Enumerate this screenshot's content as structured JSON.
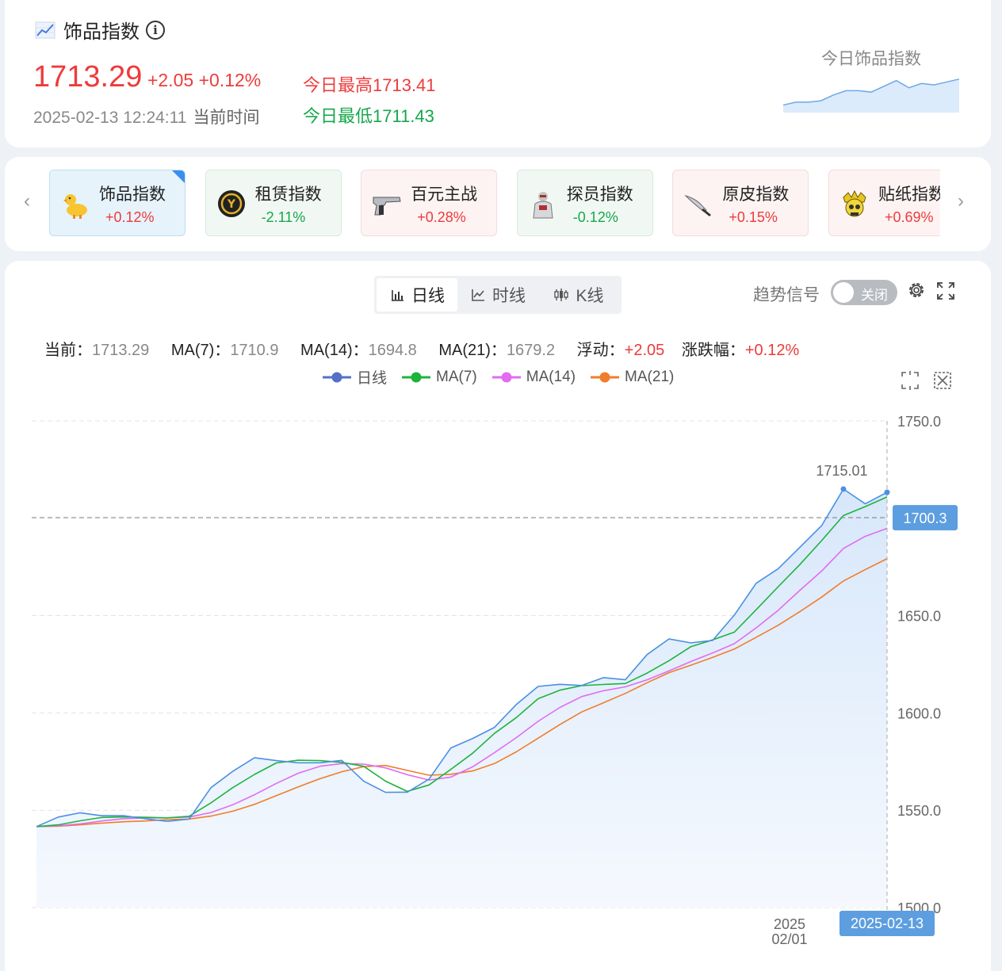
{
  "header": {
    "title": "饰品指数",
    "price": "1713.29",
    "change": "+2.05 +0.12%",
    "datetime": "2025-02-13 12:24:11",
    "datetime_suffix": "当前时间",
    "high_label": "今日最高1713.41",
    "low_label": "今日最低1711.43",
    "spark_label": "今日饰品指数",
    "spark_values": [
      1711.6,
      1711.8,
      1711.8,
      1711.9,
      1712.3,
      1712.6,
      1712.6,
      1712.5,
      1712.9,
      1713.3,
      1712.8,
      1713.1,
      1713.0,
      1713.2,
      1713.4
    ]
  },
  "tabs": [
    {
      "name": "饰品指数",
      "pct": "+0.12%",
      "state": "active",
      "icon": "duck-icon"
    },
    {
      "name": "租赁指数",
      "pct": "-2.11%",
      "state": "down",
      "icon": "coin-icon"
    },
    {
      "name": "百元主战",
      "pct": "+0.28%",
      "state": "up",
      "icon": "pistol-icon"
    },
    {
      "name": "探员指数",
      "pct": "-0.12%",
      "state": "down",
      "icon": "agent-icon"
    },
    {
      "name": "原皮指数",
      "pct": "+0.15%",
      "state": "up",
      "icon": "knife-icon"
    },
    {
      "name": "贴纸指数",
      "pct": "+0.69%",
      "state": "up",
      "icon": "skull-icon"
    }
  ],
  "toolbar": {
    "segments": [
      "日线",
      "时线",
      "K线"
    ],
    "active_segment": "日线",
    "trend_label": "趋势信号",
    "toggle_label": "关闭",
    "toggle_on": false
  },
  "stats": {
    "current_label": "当前：",
    "current_value": "1713.29",
    "ma7_label": "MA(7)：",
    "ma7_value": "1710.9",
    "ma14_label": "MA(14)：",
    "ma14_value": "1694.8",
    "ma21_label": "MA(21)：",
    "ma21_value": "1679.2",
    "float_label": "浮动：",
    "float_value": "+2.05",
    "pct_label": "涨跌幅：",
    "pct_value": "+0.12%"
  },
  "chart_data": {
    "type": "line",
    "ylim": [
      1500,
      1750
    ],
    "y_ticks": [
      "1750.0",
      "1650.0",
      "1600.0",
      "1550.0",
      "1500.0"
    ],
    "x_tick_label_line1": "2025",
    "x_tick_label_line2": "02/01",
    "x_axis_pointer_label": "2025-02-13",
    "y_axis_pointer_label": "1700.3",
    "max_label": "1715.01",
    "series": [
      {
        "name": "日线",
        "color": "#4a90e2",
        "values": [
          1541.6,
          1546.5,
          1548.7,
          1547.2,
          1547.2,
          1545.6,
          1544.3,
          1545.5,
          1561.6,
          1570.0,
          1577.0,
          1575.5,
          1574.4,
          1574.4,
          1575.6,
          1565.0,
          1559.2,
          1559.3,
          1566.0,
          1582.0,
          1586.9,
          1592.6,
          1604.3,
          1613.6,
          1614.7,
          1614.1,
          1618.1,
          1617.0,
          1630.0,
          1638.0,
          1636.0,
          1637.2,
          1650.3,
          1666.6,
          1674.0,
          1685.0,
          1696.2,
          1715.0,
          1707.4,
          1713.3
        ]
      },
      {
        "name": "MA(7)",
        "color": "#1db43c",
        "values": [
          1541.6,
          1542.5,
          1544.6,
          1546.3,
          1546.6,
          1546.4,
          1546.1,
          1546.9,
          1553.8,
          1561.6,
          1568.4,
          1574.3,
          1575.7,
          1575.5,
          1574.6,
          1572.6,
          1565.0,
          1559.7,
          1563.0,
          1571.0,
          1579.3,
          1589.5,
          1597.6,
          1607.3,
          1611.7,
          1614.0,
          1614.6,
          1615.1,
          1620.5,
          1626.8,
          1634.0,
          1637.5,
          1641.5,
          1653.0,
          1664.7,
          1676.2,
          1688.5,
          1701.4,
          1706.0,
          1710.9
        ]
      },
      {
        "name": "MA(14)",
        "color": "#e06cf0",
        "values": [
          1541.6,
          1542.0,
          1543.0,
          1544.5,
          1545.7,
          1546.0,
          1546.1,
          1546.5,
          1548.8,
          1552.8,
          1558.0,
          1563.8,
          1569.0,
          1572.6,
          1574.0,
          1573.7,
          1571.8,
          1568.3,
          1565.5,
          1567.0,
          1572.3,
          1579.6,
          1587.3,
          1595.7,
          1602.8,
          1608.4,
          1611.4,
          1613.4,
          1617.0,
          1621.6,
          1626.4,
          1630.8,
          1635.6,
          1643.7,
          1652.6,
          1662.9,
          1672.9,
          1684.5,
          1690.7,
          1694.8
        ]
      },
      {
        "name": "MA(21)",
        "color": "#f07d2a",
        "values": [
          1541.6,
          1541.8,
          1542.5,
          1543.4,
          1544.1,
          1544.5,
          1545.2,
          1545.5,
          1547.0,
          1549.5,
          1553.0,
          1557.5,
          1562.0,
          1566.2,
          1569.8,
          1572.4,
          1573.0,
          1570.5,
          1568.0,
          1568.5,
          1570.2,
          1574.0,
          1580.0,
          1587.0,
          1594.0,
          1600.5,
          1605.2,
          1610.0,
          1615.5,
          1620.7,
          1624.5,
          1628.5,
          1632.8,
          1638.8,
          1645.0,
          1652.0,
          1659.5,
          1667.8,
          1673.6,
          1679.2
        ]
      }
    ]
  }
}
